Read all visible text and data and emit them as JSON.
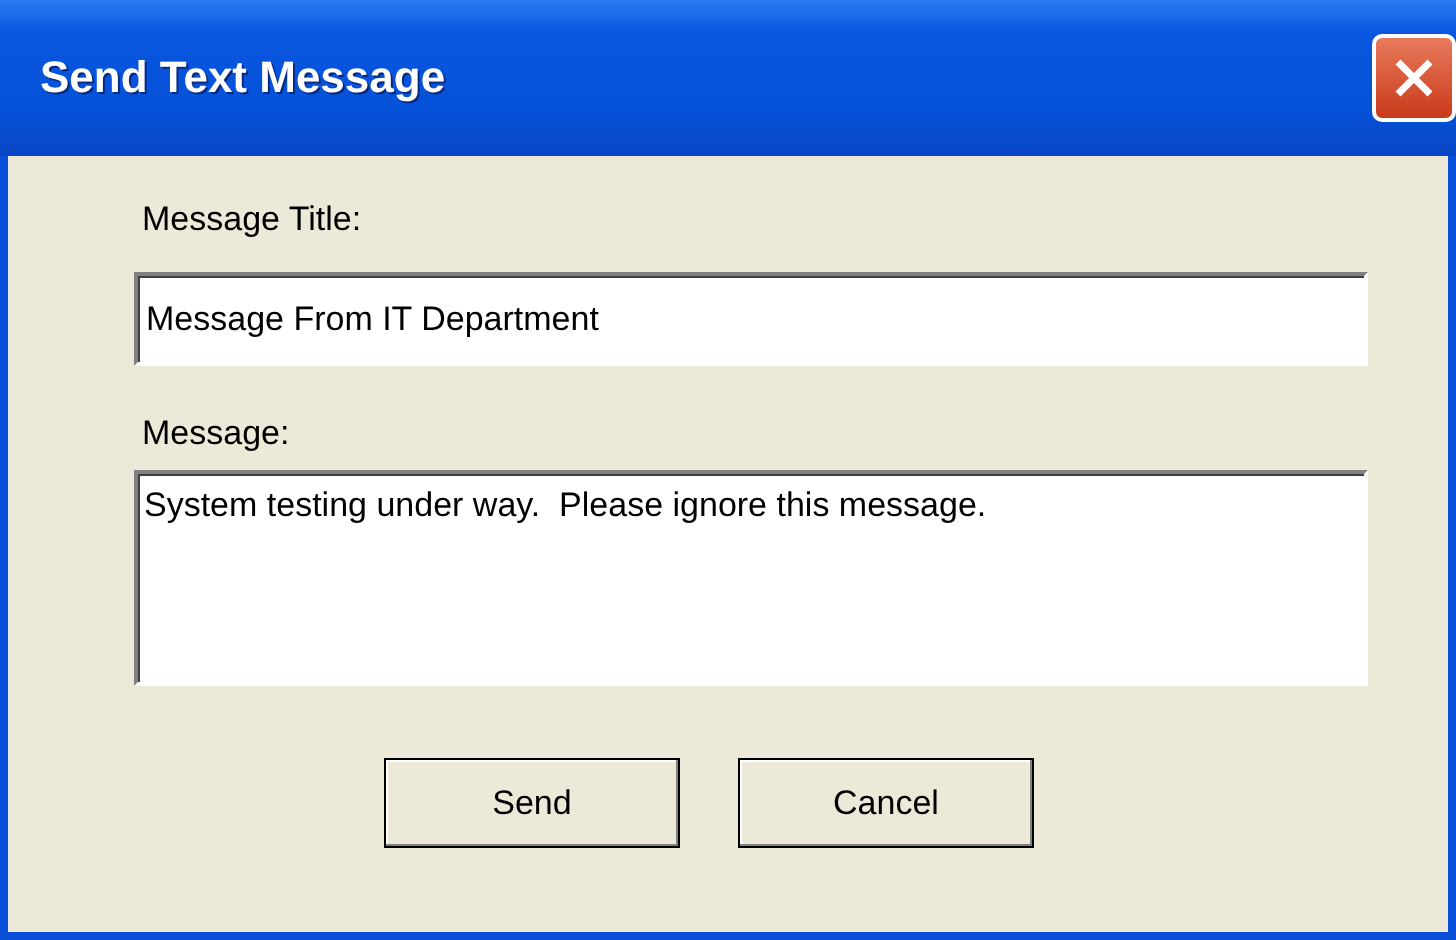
{
  "window": {
    "title": "Send Text Message"
  },
  "fields": [
    {
      "label": "Message Title:",
      "value": "Message From IT Department",
      "kind": "single"
    },
    {
      "label": "Message:",
      "value": "System testing under way.  Please ignore this message.",
      "kind": "multi"
    }
  ],
  "buttons": [
    "Send",
    "Cancel"
  ]
}
